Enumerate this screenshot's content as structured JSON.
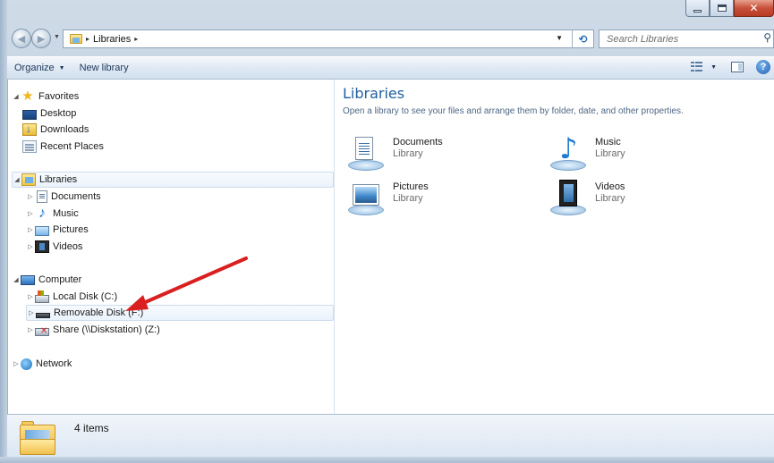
{
  "window": {
    "minimize_glyph": "",
    "close_glyph": "✕"
  },
  "address": {
    "path": [
      "Libraries"
    ],
    "separator": "▸"
  },
  "search": {
    "placeholder": "Search Libraries",
    "icon": "search-icon"
  },
  "toolbar": {
    "organize_label": "Organize",
    "new_library_label": "New library",
    "help_glyph": "?"
  },
  "nav": {
    "favorites": {
      "label": "Favorites",
      "items": [
        "Desktop",
        "Downloads",
        "Recent Places"
      ]
    },
    "libraries": {
      "label": "Libraries",
      "items": [
        "Documents",
        "Music",
        "Pictures",
        "Videos"
      ]
    },
    "computer": {
      "label": "Computer",
      "items": [
        "Local Disk (C:)",
        "Removable Disk (F:)",
        "Share (\\\\Diskstation) (Z:)"
      ]
    },
    "network": {
      "label": "Network"
    }
  },
  "main": {
    "title": "Libraries",
    "subtitle": "Open a library to see your files and arrange them by folder, date, and other properties.",
    "libraries": [
      {
        "name": "Documents",
        "type": "Library",
        "icon": "documents-library-icon"
      },
      {
        "name": "Music",
        "type": "Library",
        "icon": "music-library-icon"
      },
      {
        "name": "Pictures",
        "type": "Library",
        "icon": "pictures-library-icon"
      },
      {
        "name": "Videos",
        "type": "Library",
        "icon": "videos-library-icon"
      }
    ]
  },
  "status": {
    "item_count": "4 items"
  },
  "colors": {
    "title_blue": "#1e5e9f",
    "annotation_red": "#d91f1f",
    "hilite_border": "#cddcec"
  }
}
